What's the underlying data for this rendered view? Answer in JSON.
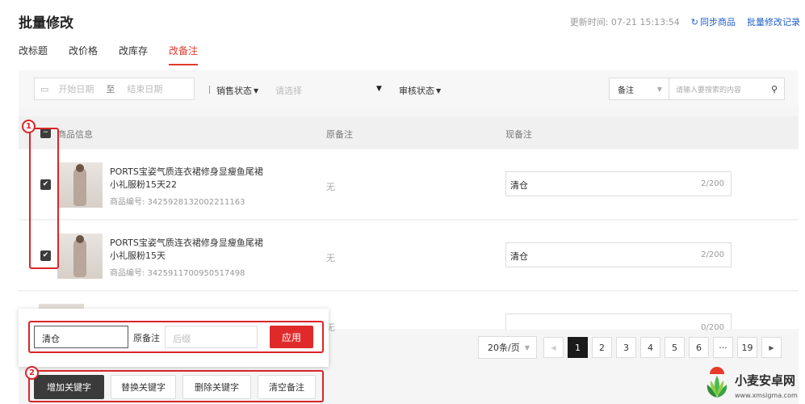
{
  "header": {
    "title": "批量修改",
    "update_time": "更新时间: 07-21 15:13:54",
    "sync_label": "同步商品",
    "history_label": "批量修改记录"
  },
  "tabs": [
    {
      "label": "改标题",
      "active": false
    },
    {
      "label": "改价格",
      "active": false
    },
    {
      "label": "改库存",
      "active": false
    },
    {
      "label": "改备注",
      "active": true
    }
  ],
  "filters": {
    "start_placeholder": "开始日期",
    "range_sep": "至",
    "end_placeholder": "结束日期",
    "sale_status_label": "销售状态",
    "select_placeholder": "请选择",
    "audit_status_label": "审核状态",
    "search_type": "备注",
    "search_placeholder": "请输入要搜索的内容"
  },
  "table": {
    "columns": [
      "商品信息",
      "原备注",
      "现备注"
    ],
    "rows": [
      {
        "checked": true,
        "name": "PORTS宝姿气质连衣裙修身显瘦鱼尾裙小礼服粉15天22",
        "product_id": "商品编号: 3425928132002211163",
        "original_note": "无",
        "new_note": "清仓",
        "count": "2/200"
      },
      {
        "checked": true,
        "name": "PORTS宝姿气质连衣裙修身显瘦鱼尾裙小礼服粉15天",
        "product_id": "商品编号: 3425911700950517498",
        "original_note": "无",
        "new_note": "清仓",
        "count": "2/200"
      }
    ],
    "third_row": {
      "original_note": "无",
      "count": "0/200"
    }
  },
  "pagination": {
    "page_size": "20条/页",
    "pages": [
      "1",
      "2",
      "3",
      "4",
      "5",
      "6",
      "···",
      "19"
    ],
    "current": "1"
  },
  "batch_editor": {
    "keyword_value": "清仓",
    "orig_label": "原备注",
    "suffix_placeholder": "后缀",
    "apply_label": "应用",
    "actions": [
      "增加关键字",
      "替换关键字",
      "删除关键字",
      "清空备注"
    ],
    "selected_action": "增加关键字"
  },
  "annotations": [
    "1",
    "2"
  ],
  "watermark": {
    "title": "小麦安卓网",
    "url": "www.xmsigma.com"
  },
  "colors": {
    "accent": "#e03a2f",
    "link": "#1e5fc8",
    "annotation": "#d9252a"
  }
}
